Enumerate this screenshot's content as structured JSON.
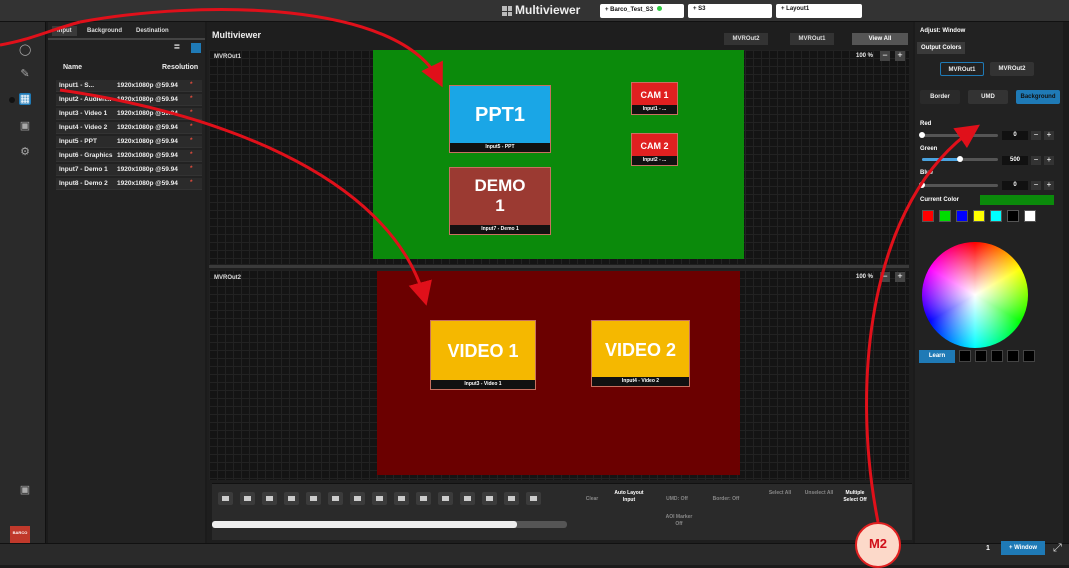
{
  "header": {
    "title": "Multiviewer",
    "tabs": [
      {
        "label": "+ Barco_Test_S3",
        "status": "online"
      },
      {
        "label": "+ S3"
      },
      {
        "label": "+ Layout1"
      }
    ]
  },
  "left_rail": {
    "icons": [
      "network-icon",
      "edit-icon",
      "layout-icon",
      "display-icon",
      "gear-icon",
      "save-icon"
    ],
    "logo_text": "BARCO"
  },
  "input_panel": {
    "tabs": [
      "Input",
      "Background",
      "Destination"
    ],
    "active_tab": "Input",
    "columns": [
      "Name",
      "Resolution"
    ],
    "rows": [
      {
        "name": "Input1 - S...",
        "resolution": "1920x1080p @59.94"
      },
      {
        "name": "Input2 - Audien...",
        "resolution": "1920x1080p @59.94"
      },
      {
        "name": "Input3 - Video 1",
        "resolution": "1920x1080p @59.94"
      },
      {
        "name": "Input4 - Video 2",
        "resolution": "1920x1080p @59.94"
      },
      {
        "name": "Input5 - PPT",
        "resolution": "1920x1080p @59.94"
      },
      {
        "name": "Input6 - Graphics",
        "resolution": "1920x1080p @59.94"
      },
      {
        "name": "Input7 - Demo 1",
        "resolution": "1920x1080p @59.94"
      },
      {
        "name": "Input8 - Demo 2",
        "resolution": "1920x1080p @59.94"
      }
    ]
  },
  "workarea": {
    "title": "Multiviewer",
    "tabs": [
      "MVROut2",
      "MVROut1",
      "View All"
    ],
    "active_tab": "View All",
    "canvases": [
      {
        "label": "MVROut1",
        "zoom": "100 %",
        "background": "#0b8a0b",
        "windows": [
          {
            "id": "ppt1",
            "text": "PPT1",
            "label": "Input5 - PPT",
            "color": "#1aa6e6"
          },
          {
            "id": "cam1",
            "text": "CAM 1",
            "label": "Input1 - ...",
            "color": "#e02020"
          },
          {
            "id": "cam2",
            "text": "CAM 2",
            "label": "Input2 - ...",
            "color": "#e02020"
          },
          {
            "id": "demo1",
            "text": "DEMO 1",
            "label": "Input7 - Demo 1",
            "color": "#9b3a32"
          }
        ]
      },
      {
        "label": "MVROut2",
        "zoom": "100 %",
        "background": "#6b0000",
        "windows": [
          {
            "id": "video1",
            "text": "VIDEO 1",
            "label": "Input3 - Video 1",
            "color": "#f5b800"
          },
          {
            "id": "video2",
            "text": "VIDEO 2",
            "label": "Input4 - Video 2",
            "color": "#f5b800"
          }
        ]
      }
    ]
  },
  "toolbar": {
    "clear": "Clear",
    "auto_layout": "Auto Layout Input",
    "umd": "UMD: Off",
    "border": "Border: Off",
    "aoi_marker": "AOI Marker Off",
    "select_all": "Select All",
    "unselect_all": "Unselect All",
    "multiple_select": "Multiple Select Off",
    "progress": 0.86
  },
  "adjust_panel": {
    "header": "Adjust: Window",
    "section": "Output Colors",
    "outputs": [
      "MVROut1",
      "MVROut2"
    ],
    "active_output": "MVROut1",
    "modes": [
      "Border",
      "UMD",
      "Background"
    ],
    "active_mode": "Background",
    "sliders": [
      {
        "label": "Red",
        "value": "0",
        "fraction": 0.0
      },
      {
        "label": "Green",
        "value": "500",
        "fraction": 0.5
      },
      {
        "label": "Blue",
        "value": "0",
        "fraction": 0.0
      }
    ],
    "current_color_label": "Current Color",
    "current_color": "#0b8a0b",
    "swatches": [
      "#ff0000",
      "#00dd00",
      "#0000ff",
      "#ffff00",
      "#00ffff",
      "#000000",
      "#ffffff"
    ],
    "learn": "Learn"
  },
  "footer": {
    "page": "1",
    "add_window": "+ Window"
  },
  "annotations": {
    "badge": "M2"
  }
}
